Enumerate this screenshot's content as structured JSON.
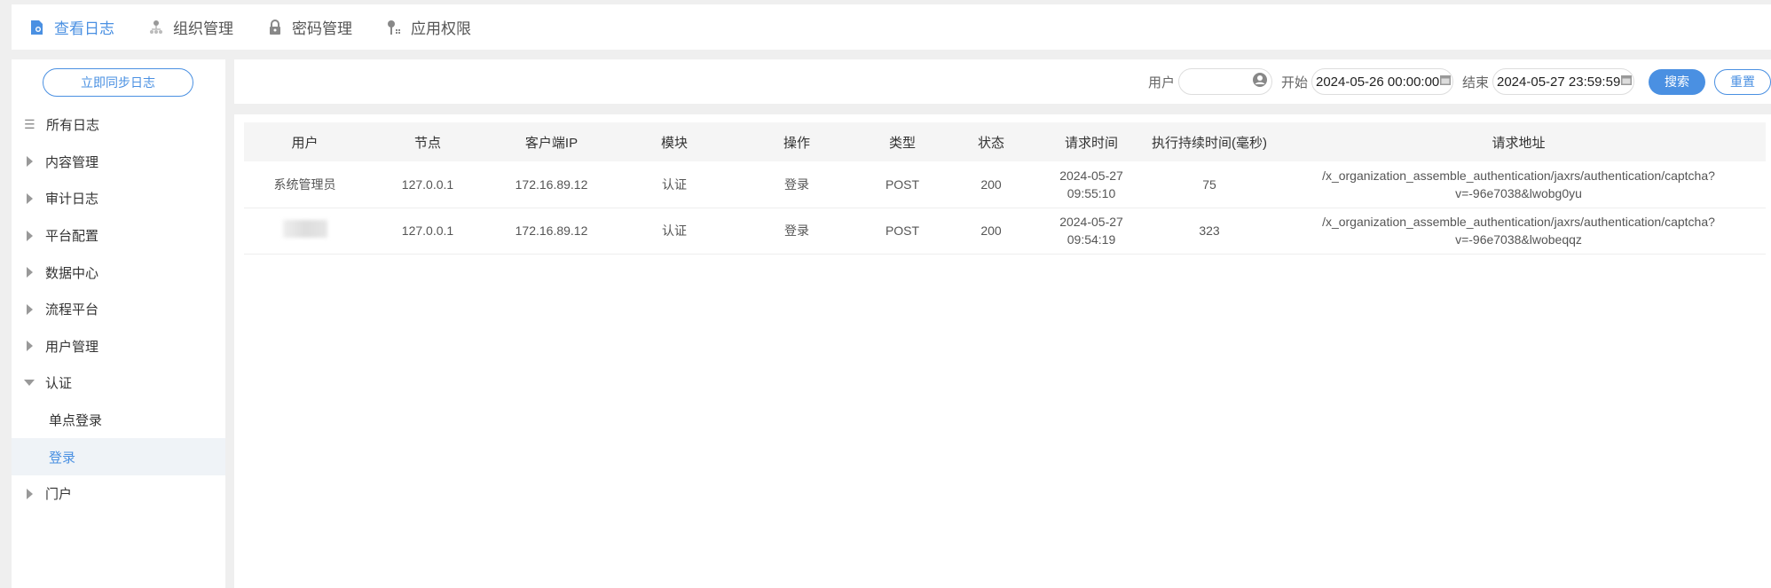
{
  "topnav": [
    {
      "label": "查看日志",
      "icon": "log-view-icon",
      "active": true
    },
    {
      "label": "组织管理",
      "icon": "org-tree-icon"
    },
    {
      "label": "密码管理",
      "icon": "lock-icon"
    },
    {
      "label": "应用权限",
      "icon": "key-icon"
    }
  ],
  "sidebar": {
    "sync_label": "立即同步日志",
    "items": [
      {
        "label": "所有日志"
      },
      {
        "label": "内容管理"
      },
      {
        "label": "审计日志"
      },
      {
        "label": "平台配置"
      },
      {
        "label": "数据中心"
      },
      {
        "label": "流程平台"
      },
      {
        "label": "用户管理"
      },
      {
        "label": "认证"
      },
      {
        "label": "单点登录"
      },
      {
        "label": "登录"
      },
      {
        "label": "门户"
      }
    ]
  },
  "toolbar": {
    "user_label": "用户",
    "user_value": "",
    "start_label": "开始",
    "start_value": "2024-05-26 00:00:00",
    "end_label": "结束",
    "end_value": "2024-05-27 23:59:59",
    "search": "搜索",
    "reset": "重置"
  },
  "table": {
    "headers": [
      "用户",
      "节点",
      "客户端IP",
      "模块",
      "操作",
      "类型",
      "状态",
      "请求时间",
      "执行持续时间(毫秒)",
      "请求地址"
    ],
    "rows": [
      {
        "user": "系统管理员",
        "node": "127.0.0.1",
        "ip": "172.16.89.12",
        "module": "认证",
        "op": "登录",
        "type": "POST",
        "status": "200",
        "date": "2024-05-27",
        "time": "09:55:10",
        "duration": "75",
        "url1": "/x_organization_assemble_authentication/jaxrs/authentication/captcha?",
        "url2": "v=-96e7038&lwobg0yu"
      },
      {
        "user": "",
        "node": "127.0.0.1",
        "ip": "172.16.89.12",
        "module": "认证",
        "op": "登录",
        "type": "POST",
        "status": "200",
        "date": "2024-05-27",
        "time": "09:54:19",
        "duration": "323",
        "url1": "/x_organization_assemble_authentication/jaxrs/authentication/captcha?",
        "url2": "v=-96e7038&lwobeqqz"
      }
    ]
  },
  "colors": {
    "accent": "#4a90e2",
    "bg": "#efefef"
  }
}
